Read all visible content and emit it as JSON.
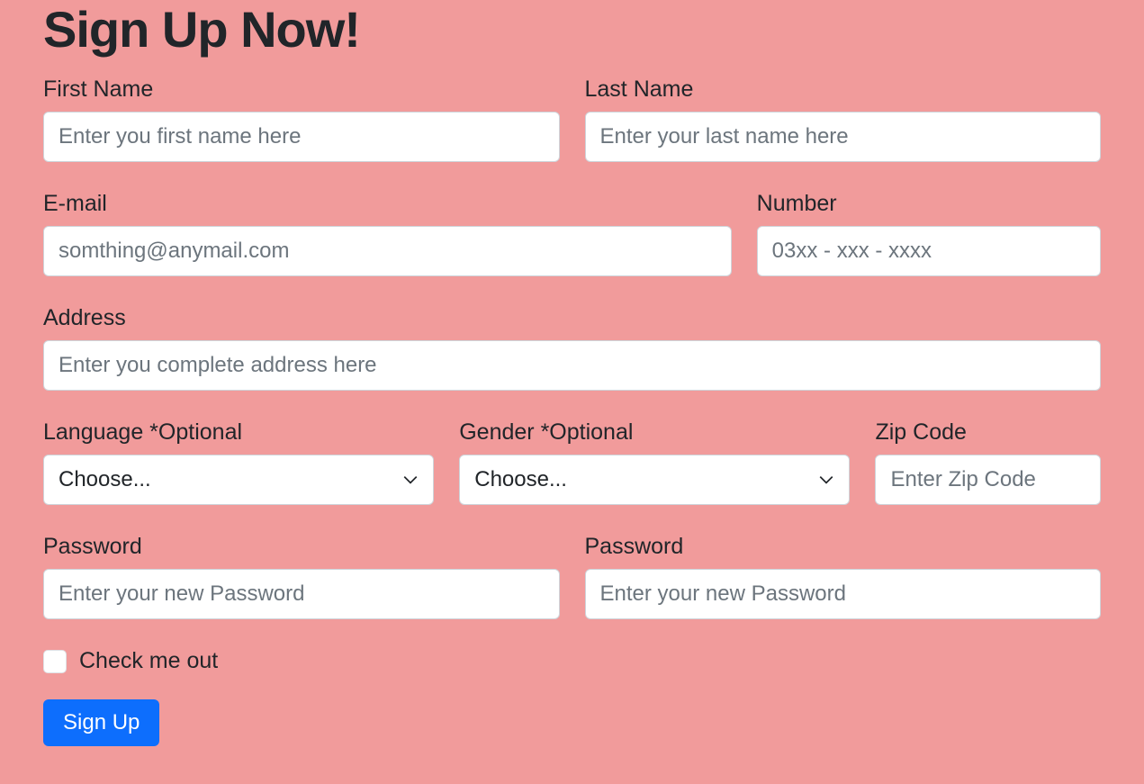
{
  "title": "Sign Up Now!",
  "firstName": {
    "label": "First Name",
    "placeholder": "Enter you first name here"
  },
  "lastName": {
    "label": "Last Name",
    "placeholder": "Enter your last name here"
  },
  "email": {
    "label": "E-mail",
    "placeholder": "somthing@anymail.com"
  },
  "number": {
    "label": "Number",
    "placeholder": "03xx - xxx - xxxx"
  },
  "address": {
    "label": "Address",
    "placeholder": "Enter you complete address here"
  },
  "language": {
    "label": "Language *Optional",
    "selected": "Choose..."
  },
  "gender": {
    "label": "Gender *Optional",
    "selected": "Choose..."
  },
  "zip": {
    "label": "Zip Code",
    "placeholder": "Enter Zip Code"
  },
  "password1": {
    "label": "Password",
    "placeholder": "Enter your new Password"
  },
  "password2": {
    "label": "Password",
    "placeholder": "Enter your new Password"
  },
  "checkbox": {
    "label": "Check me out"
  },
  "submit": {
    "label": "Sign Up"
  }
}
